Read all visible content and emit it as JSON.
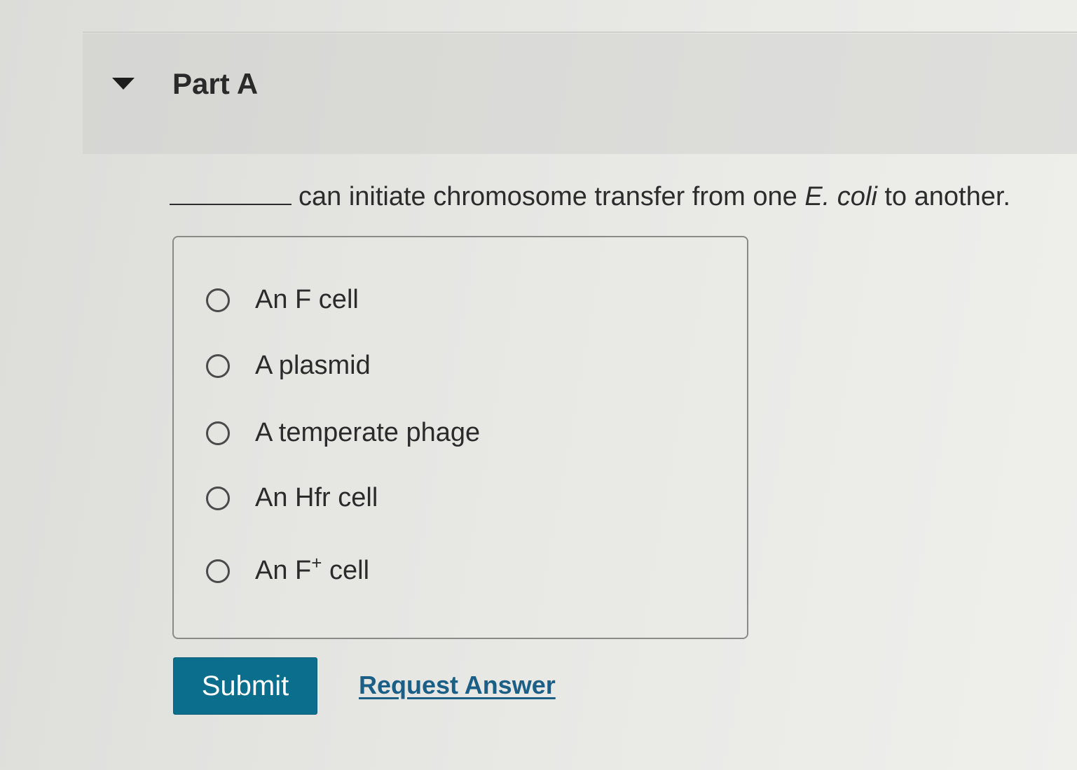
{
  "part": {
    "title": "Part A",
    "expanded": true
  },
  "question": {
    "text_before": "can initiate chromosome transfer from one",
    "organism": "E. coli",
    "text_after": "to another."
  },
  "choices": [
    {
      "label": "An F",
      "superscript": "",
      "label_after": " cell",
      "selected": false
    },
    {
      "label": "A plasmid",
      "superscript": "",
      "label_after": "",
      "selected": false
    },
    {
      "label": "A temperate phage",
      "superscript": "",
      "label_after": "",
      "selected": false
    },
    {
      "label": "An Hfr cell",
      "superscript": "",
      "label_after": "",
      "selected": false
    },
    {
      "label": "An F",
      "superscript": "+",
      "label_after": " cell",
      "selected": false
    }
  ],
  "actions": {
    "submit_label": "Submit",
    "request_answer_label": "Request Answer"
  },
  "colors": {
    "submit_background": "#0b6e8c",
    "link": "#1b5f86"
  }
}
